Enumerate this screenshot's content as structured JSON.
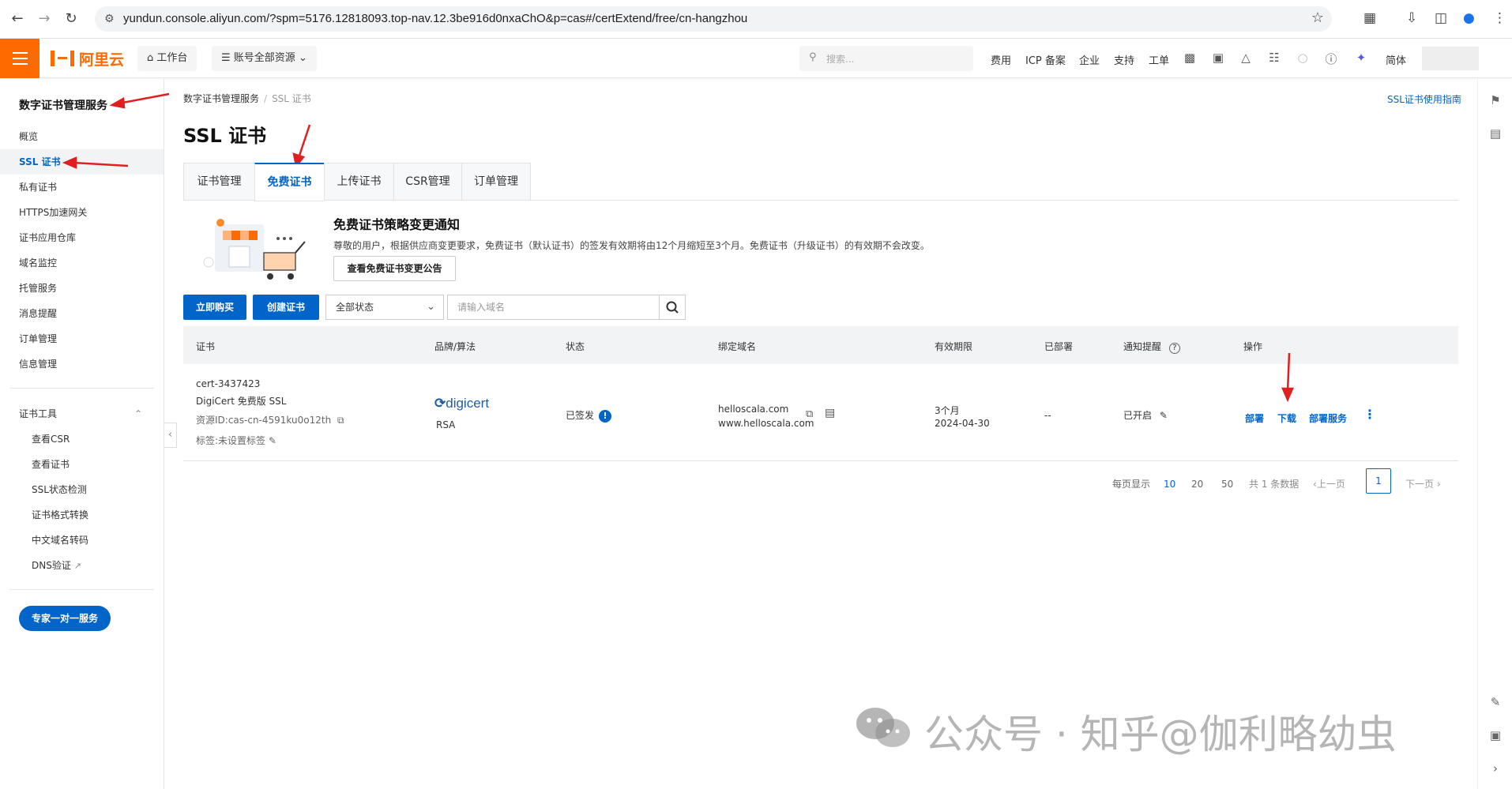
{
  "browser": {
    "url": "yundun.console.aliyun.com/?spm=5176.12818093.top-nav.12.3be916d0nxaChO&p=cas#/certExtend/free/cn-hangzhou"
  },
  "topbar": {
    "logo": "阿里云",
    "workbench": "工作台",
    "resources": "账号全部资源",
    "search_placeholder": "搜索...",
    "links": [
      "费用",
      "ICP 备案",
      "企业",
      "支持",
      "工单"
    ],
    "lang": "简体",
    "accent": "#ff6a00"
  },
  "sidebar": {
    "title": "数字证书管理服务",
    "items": [
      "概览",
      "SSL 证书",
      "私有证书",
      "HTTPS加速网关",
      "证书应用仓库",
      "域名监控",
      "托管服务",
      "消息提醒",
      "订单管理",
      "信息管理"
    ],
    "tools_title": "证书工具",
    "tools": [
      "查看CSR",
      "查看证书",
      "SSL状态检测",
      "证书格式转换",
      "中文域名转码",
      "DNS验证"
    ],
    "expert_button": "专家一对一服务"
  },
  "main": {
    "breadcrumb_parent": "数字证书管理服务",
    "breadcrumb_current": "SSL 证书",
    "guide_link": "SSL证书使用指南",
    "title": "SSL 证书",
    "tabs": [
      "证书管理",
      "免费证书",
      "上传证书",
      "CSR管理",
      "订单管理"
    ],
    "active_tab": "免费证书",
    "notice": {
      "title": "免费证书策略变更通知",
      "text": "尊敬的用户，根据供应商变更要求，免费证书（默认证书）的签发有效期将由12个月缩短至3个月。免费证书（升级证书）的有效期不会改变。",
      "button": "查看免费证书变更公告"
    },
    "toolbar": {
      "buy_button": "立即购买",
      "create_button": "创建证书",
      "status_select": "全部状态",
      "domain_placeholder": "请输入域名"
    },
    "table": {
      "headers": [
        "证书",
        "品牌/算法",
        "状态",
        "绑定域名",
        "有效期限",
        "已部署",
        "通知提醒",
        "操作"
      ],
      "row": {
        "cert_name": "cert-3437423",
        "cert_type": "DigiCert 免费版 SSL",
        "resource_id": "资源ID:cas-cn-4591ku0o12th",
        "tags": "标签:未设置标签",
        "brand": "digicert",
        "algorithm": "RSA",
        "status": "已签发",
        "domain1": "helloscala.com",
        "domain2": "www.helloscala.com",
        "validity": "3个月",
        "expiry": "2024-04-30",
        "deployed": "--",
        "notify": "已开启",
        "actions": [
          "部署",
          "下载",
          "部署服务"
        ]
      }
    },
    "pagination": {
      "per_page_label": "每页显示",
      "sizes": [
        "10",
        "20",
        "50"
      ],
      "total": "共 1 条数据",
      "prev": "上一页",
      "current": "1",
      "next": "下一页"
    }
  },
  "watermark": "公众号 · 知乎@伽利略幼虫",
  "annotation_color": "#e02020"
}
